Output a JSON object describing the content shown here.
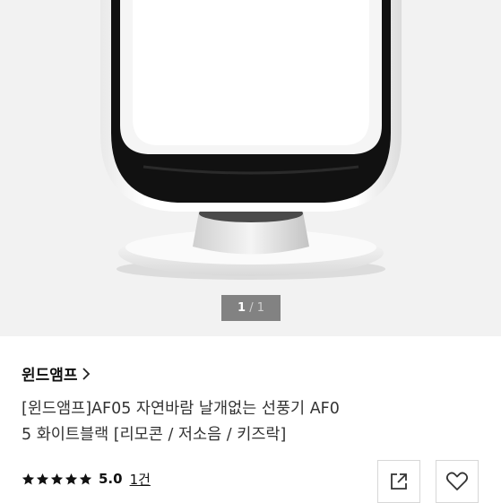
{
  "product_image": {
    "pager_current": "1",
    "pager_separator": "/",
    "pager_total": "1"
  },
  "brand": {
    "name": "윈드앰프",
    "icon": "chevron-right-icon"
  },
  "product": {
    "title_line1": "[윈드앰프]AF05 자연바람 날개없는 선풍기 AF0",
    "title_line2": "5 화이트블랙 [리모콘 / 저소음 / 키즈락]"
  },
  "rating": {
    "stars": 5,
    "score": "5.0",
    "review_count": "1건"
  },
  "actions": {
    "share_icon": "share-icon",
    "like_icon": "heart-icon"
  },
  "colors": {
    "hero_background": "#f2f2f2",
    "pager_background": "#6e6e6e"
  }
}
